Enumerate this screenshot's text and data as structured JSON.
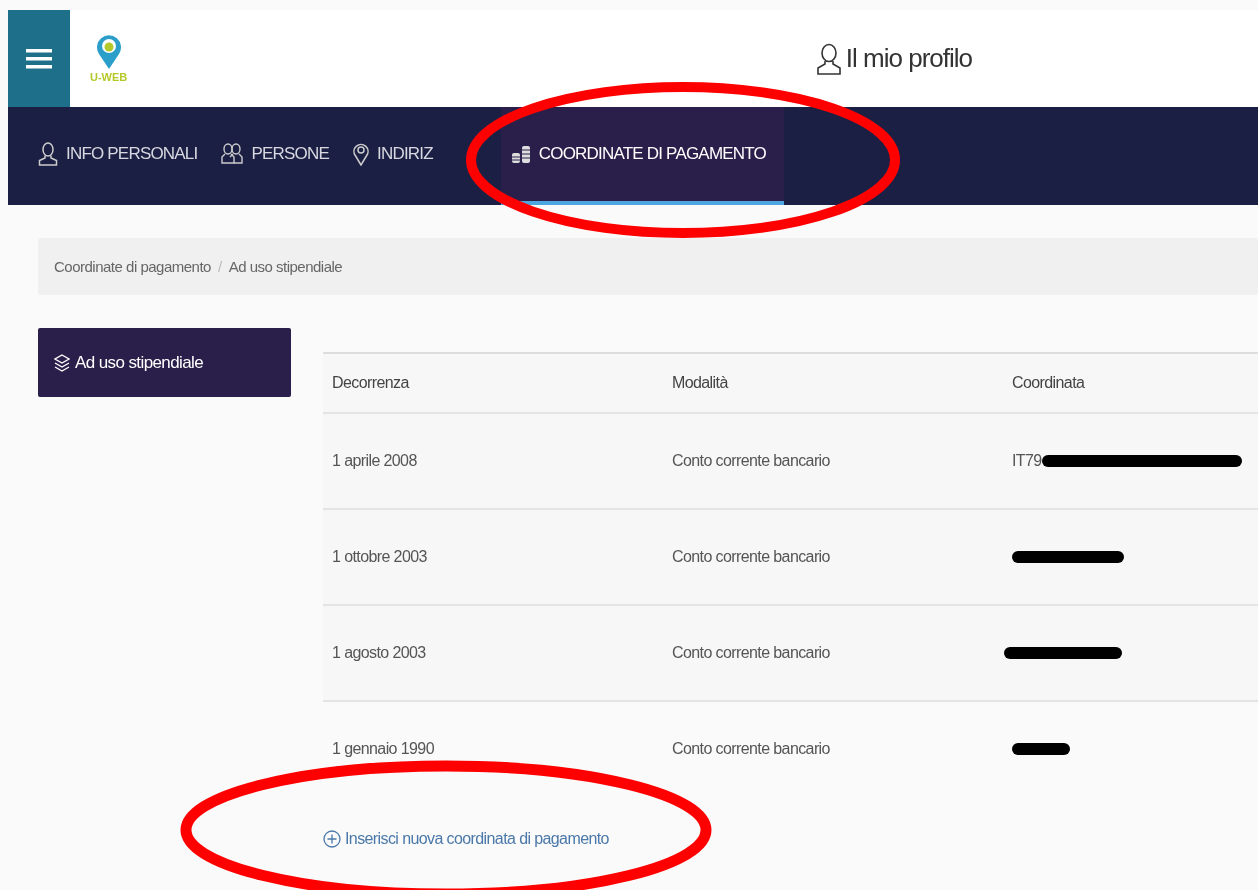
{
  "header": {
    "logo_text": "U-WEB",
    "profile_label": "Il mio profilo"
  },
  "tabs": [
    {
      "label": "INFO PERSONALI",
      "selected": false
    },
    {
      "label": "PERSONE",
      "selected": false
    },
    {
      "label": "INDIRIZ",
      "selected": false
    },
    {
      "label": "COORDINATE DI PAGAMENTO",
      "selected": true
    }
  ],
  "breadcrumb": [
    "Coordinate di pagamento",
    "Ad uso stipendiale"
  ],
  "breadcrumb_separator": "/",
  "sidebar": {
    "items": [
      {
        "label": "Ad uso stipendiale",
        "selected": true
      }
    ]
  },
  "table": {
    "columns": [
      "Decorrenza",
      "Modalità",
      "Coordinata"
    ],
    "rows": [
      {
        "decorrenza": "1 aprile 2008",
        "modalita": "Conto corrente bancario",
        "coordinata": "IT79",
        "redacted": true
      },
      {
        "decorrenza": "1 ottobre 2003",
        "modalita": "Conto corrente bancario",
        "redacted": true
      },
      {
        "decorrenza": "1 agosto 2003",
        "modalita": "Conto corrente bancario",
        "redacted": true
      },
      {
        "decorrenza": "1 gennaio 1990",
        "modalita": "Conto corrente bancario",
        "redacted": true
      }
    ]
  },
  "add_link": "Inserisci nuova coordinata di pagamento"
}
